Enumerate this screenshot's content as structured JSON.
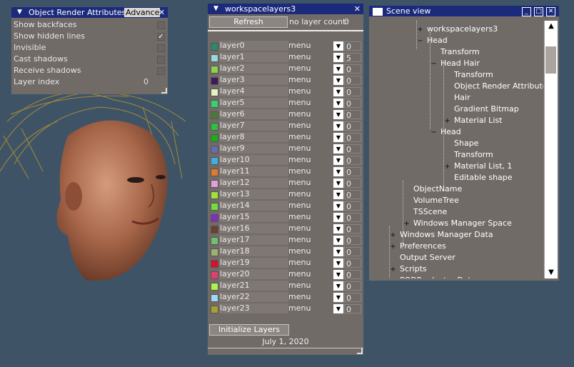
{
  "ora_panel": {
    "title": "Object Render Attributes",
    "advanced_label": "Advanced",
    "rows": [
      {
        "label": "Show backfaces",
        "checked": false
      },
      {
        "label": "Show hidden lines",
        "checked": true
      },
      {
        "label": "Invisible",
        "checked": false
      },
      {
        "label": "Cast shadows",
        "checked": false
      },
      {
        "label": "Receive shadows",
        "checked": false
      }
    ],
    "layer_index_label": "Layer index",
    "layer_index_value": "0"
  },
  "workspace_layers": {
    "title": "workspacelayers3",
    "refresh_label": "Refresh",
    "no_layer_count_label": "no layer count:",
    "no_layer_count_value": "0",
    "menu_label": "menu",
    "layers": [
      {
        "name": "layer0",
        "value": "0",
        "color": "#2a8a6a"
      },
      {
        "name": "layer1",
        "value": "5",
        "color": "#9ad8e0"
      },
      {
        "name": "layer2",
        "value": "0",
        "color": "#8cd050"
      },
      {
        "name": "layer3",
        "value": "0",
        "color": "#3e1a5c"
      },
      {
        "name": "layer4",
        "value": "0",
        "color": "#e8f0c0"
      },
      {
        "name": "layer5",
        "value": "0",
        "color": "#3ad070"
      },
      {
        "name": "layer6",
        "value": "0",
        "color": "#4a7a3a"
      },
      {
        "name": "layer7",
        "value": "0",
        "color": "#30c040"
      },
      {
        "name": "layer8",
        "value": "0",
        "color": "#18b018"
      },
      {
        "name": "layer9",
        "value": "0",
        "color": "#6a6ab0"
      },
      {
        "name": "layer10",
        "value": "0",
        "color": "#40b0e0"
      },
      {
        "name": "layer11",
        "value": "0",
        "color": "#e07830"
      },
      {
        "name": "layer12",
        "value": "0",
        "color": "#e0a0d8"
      },
      {
        "name": "layer13",
        "value": "0",
        "color": "#a0e040"
      },
      {
        "name": "layer14",
        "value": "0",
        "color": "#70e040"
      },
      {
        "name": "layer15",
        "value": "0",
        "color": "#8030c0"
      },
      {
        "name": "layer16",
        "value": "0",
        "color": "#6a4030"
      },
      {
        "name": "layer17",
        "value": "0",
        "color": "#70c070"
      },
      {
        "name": "layer18",
        "value": "0",
        "color": "#a0b070"
      },
      {
        "name": "layer19",
        "value": "0",
        "color": "#d81030"
      },
      {
        "name": "layer20",
        "value": "0",
        "color": "#e04070"
      },
      {
        "name": "layer21",
        "value": "0",
        "color": "#b0f050"
      },
      {
        "name": "layer22",
        "value": "0",
        "color": "#a0d8f0"
      },
      {
        "name": "layer23",
        "value": "0",
        "color": "#a8a030"
      }
    ],
    "init_label": "Initialize Layers",
    "date": "July 1, 2020"
  },
  "scene_view": {
    "title": "Scene view",
    "nodes": [
      {
        "label": "workspacelayers3",
        "level": 3,
        "exp": "+"
      },
      {
        "label": "Head",
        "level": 3,
        "exp": "-"
      },
      {
        "label": "Transform",
        "level": 4,
        "exp": ""
      },
      {
        "label": "Head Hair",
        "level": 4,
        "exp": "-"
      },
      {
        "label": "Transform",
        "level": 5,
        "exp": ""
      },
      {
        "label": "Object Render Attributes",
        "level": 5,
        "exp": ""
      },
      {
        "label": "Hair",
        "level": 5,
        "exp": ""
      },
      {
        "label": "Gradient Bitmap",
        "level": 5,
        "exp": ""
      },
      {
        "label": "Material List",
        "level": 5,
        "exp": "+"
      },
      {
        "label": "Head",
        "level": 4,
        "exp": "-"
      },
      {
        "label": "Shape",
        "level": 5,
        "exp": ""
      },
      {
        "label": "Transform",
        "level": 5,
        "exp": ""
      },
      {
        "label": "Material List, 1",
        "level": 5,
        "exp": "+"
      },
      {
        "label": "Editable shape",
        "level": 5,
        "exp": ""
      },
      {
        "label": "ObjectName",
        "level": 2,
        "exp": ""
      },
      {
        "label": "VolumeTree",
        "level": 2,
        "exp": ""
      },
      {
        "label": "TSScene",
        "level": 2,
        "exp": ""
      },
      {
        "label": "Windows Manager Space",
        "level": 2,
        "exp": "+"
      },
      {
        "label": "Windows Manager Data",
        "level": 1,
        "exp": "+"
      },
      {
        "label": "Preferences",
        "level": 1,
        "exp": "+"
      },
      {
        "label": "Output Server",
        "level": 1,
        "exp": ""
      },
      {
        "label": "Scripts",
        "level": 1,
        "exp": "+"
      },
      {
        "label": "PQDProductor Data",
        "level": 1,
        "exp": "+"
      }
    ]
  }
}
